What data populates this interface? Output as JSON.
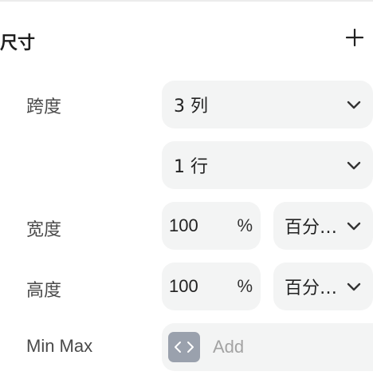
{
  "section": {
    "title": "尺寸",
    "add_icon": "plus-icon"
  },
  "span": {
    "label": "跨度",
    "columns_value": "3 列",
    "rows_value": "1 行"
  },
  "width": {
    "label": "宽度",
    "value": "100",
    "unit": "%",
    "mode": "百分…"
  },
  "height": {
    "label": "高度",
    "value": "100",
    "unit": "%",
    "mode": "百分…"
  },
  "minmax": {
    "label": "Min Max",
    "placeholder": "Add",
    "icon": "code-icon"
  },
  "colors": {
    "field_bg": "#f3f4f4",
    "chip_bg": "#9aa1ad",
    "placeholder": "#a3a3a3"
  }
}
